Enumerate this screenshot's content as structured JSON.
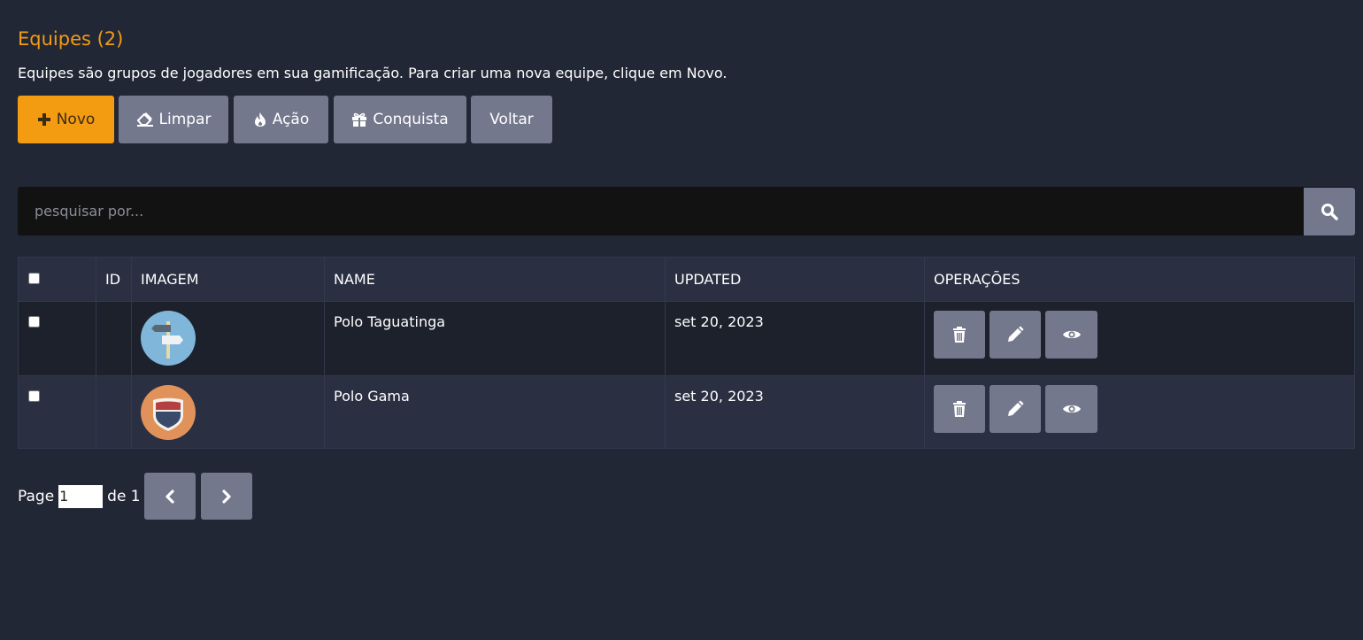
{
  "header": {
    "title": "Equipes (2)",
    "description": "Equipes são grupos de jogadores em sua gamificação. Para criar uma nova equipe, clique em Novo."
  },
  "toolbar": {
    "new_label": "Novo",
    "clear_label": "Limpar",
    "action_label": "Ação",
    "achievement_label": "Conquista",
    "back_label": "Voltar"
  },
  "search": {
    "placeholder": "pesquisar por..."
  },
  "table": {
    "columns": [
      "",
      "ID",
      "IMAGEM",
      "NAME",
      "UPDATED",
      "OPERAÇÕES"
    ],
    "rows": [
      {
        "name": "Polo Taguatinga",
        "updated": "set 20, 2023",
        "image_icon": "signpost-icon"
      },
      {
        "name": "Polo Gama",
        "updated": "set 20, 2023",
        "image_icon": "shield-badge-icon"
      }
    ]
  },
  "pagination": {
    "page_label": "Page",
    "current_page": "1",
    "of_label": "de 1"
  },
  "colors": {
    "background": "#222736",
    "accent": "#f39c12",
    "button": "#74788d",
    "search_bg": "#121212"
  }
}
